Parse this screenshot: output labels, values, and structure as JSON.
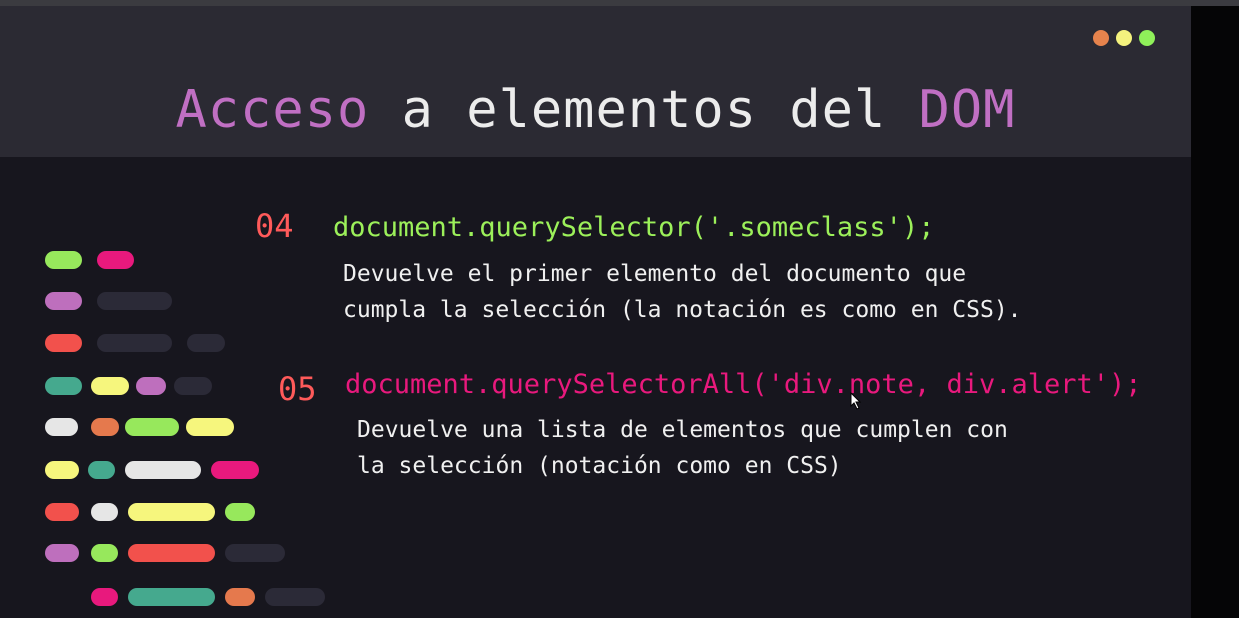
{
  "window_dots": [
    {
      "name": "dot-orange",
      "color": "#e6834d"
    },
    {
      "name": "dot-yellow",
      "color": "#f4f27e"
    },
    {
      "name": "dot-green",
      "color": "#8ff05a"
    }
  ],
  "title": {
    "part1": "Acceso",
    "part2": " a elementos del ",
    "part3": "DOM"
  },
  "items": [
    {
      "number": "04",
      "number_color": "#ff5a5a",
      "code": "document.querySelector('.someclass');",
      "code_color": "#9cf05a",
      "desc_lines": [
        "Devuelve el primer elemento del documento que",
        "cumpla la selección (la notación es como en CSS)."
      ]
    },
    {
      "number": "05",
      "number_color": "#ff5a5a",
      "code": "document.querySelectorAll('div.note, div.alert');",
      "code_color": "#e8197d",
      "desc_lines": [
        "Devuelve una lista de elementos que cumplen con",
        "la selección (notación como en CSS)"
      ]
    }
  ],
  "colors": {
    "green": "#97e85c",
    "pink": "#e8197d",
    "purple": "#be6fbd",
    "dark": "#2b2a37",
    "red": "#f2514c",
    "teal": "#45a98e",
    "yellow": "#f6f67d",
    "white": "#e6e6e6",
    "orange": "#e5794d"
  }
}
